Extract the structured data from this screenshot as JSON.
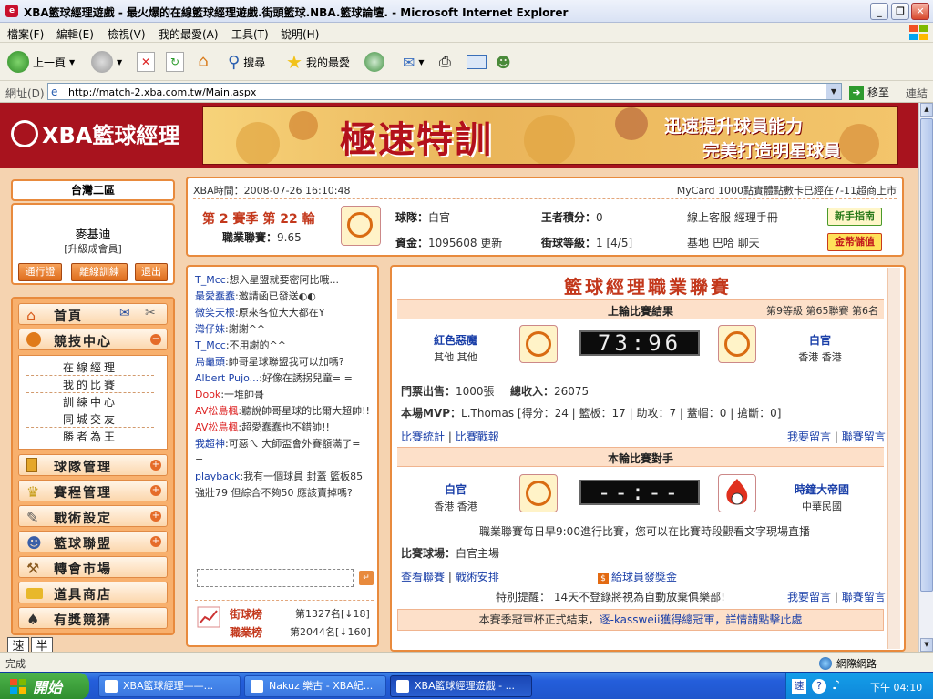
{
  "window": {
    "title": "XBA籃球經理遊戲 - 最火爆的在線籃球經理遊戲.街頭籃球.NBA.籃球論壇. - Microsoft Internet Explorer"
  },
  "menu": [
    "檔案(F)",
    "編輯(E)",
    "檢視(V)",
    "我的最愛(A)",
    "工具(T)",
    "說明(H)"
  ],
  "toolbar": {
    "back": "上一頁",
    "search": "搜尋",
    "favorites": "我的最愛"
  },
  "address": {
    "label": "網址(D)",
    "url": "http://match-2.xba.com.tw/Main.aspx",
    "go": "移至",
    "links": "連結"
  },
  "header": {
    "logo": "XBA籃球經理",
    "banner_big": "極速特訓",
    "banner_line1": "迅速提升球員能力",
    "banner_line2": "完美打造明星球員"
  },
  "left": {
    "server": "台灣二區",
    "user_name": "麥基迪",
    "user_role": "[升級成會員]",
    "buttons": [
      "通行證",
      "離線訓練",
      "退出"
    ],
    "nav": {
      "home": "首頁",
      "competition": "競技中心",
      "sub": [
        "在線經理",
        "我的比賽",
        "訓練中心",
        "同城交友",
        "勝者為王"
      ],
      "team": "球隊管理",
      "schedule": "賽程管理",
      "tactics": "戰術設定",
      "alliance": "籃球聯盟",
      "transfer": "轉會市場",
      "shop": "道具商店",
      "prize": "有獎競猜"
    },
    "speed": [
      "速",
      "半"
    ]
  },
  "info": {
    "time_label": "XBA時間：",
    "time": "2008-07-26 16:10:48",
    "news": "MyCard 1000點實體點數卡已經在7-11超商上市",
    "season": "第 2 賽季  第 22 輪",
    "league_label": "職業聯賽：",
    "league_value": "9.65",
    "team_label": "球隊：",
    "team": "白官",
    "king_label": "王者積分：",
    "king": "0",
    "service": "線上客服  經理手冊",
    "newbie": "新手指南",
    "money_label": "資金：",
    "money": "1095608",
    "update": "更新",
    "level_label": "街球等級：",
    "level": "1 [4/5]",
    "links": "基地  巴哈  聊天",
    "gold": "金幣儲值"
  },
  "chat": {
    "lines": [
      {
        "nick": "T_Mcc",
        "msg": ":想入星盟就要密阿比哦..."
      },
      {
        "nick": "最愛蠢蠢",
        "msg": ":邀請函已發送◐◐"
      },
      {
        "nick": "微笑天根",
        "msg": ":原來各位大大都在Y"
      },
      {
        "nick": "灣仔妹",
        "msg": ":謝謝^^"
      },
      {
        "nick": "T_Mcc",
        "msg": ":不用謝的^^"
      },
      {
        "nick": "烏龜頭",
        "msg": ":帥哥星球聯盟我可以加嗎?"
      },
      {
        "nick": "Albert Pujo...",
        "msg": ":好像在誘拐兒童= ="
      },
      {
        "nick": "Dook",
        "msg": ":一堆帥哥"
      },
      {
        "nick": "AV松島楓",
        "msg": ":聽說帥哥星球的比爾大超帥!!"
      },
      {
        "nick": "AV松島楓",
        "msg": ":超愛蠢蠢也不錯帥!!"
      },
      {
        "nick": "我超神",
        "msg": ":可惡ㄟ 大師盃會外賽額滿了= ="
      },
      {
        "nick": "playback",
        "msg": ":我有一個球員 封蓋 籃板85 強壯79 但綜合不夠50 應該賣掉嗎?"
      }
    ],
    "rank1_label": "街球榜",
    "rank1": "第1327名[↓18]",
    "rank2_label": "職業榜",
    "rank2": "第2044名[↓160]"
  },
  "league": {
    "title": "籃球經理職業聯賽",
    "last_title": "上輪比賽結果",
    "last_info": "第9等級  第65聯賽  第6名",
    "home_team": "紅色惡魔",
    "home_region": "其他  其他",
    "score": "73:96",
    "away_team": "白官",
    "away_region": "香港  香港",
    "tickets_label": "門票出售：",
    "tickets": "1000張",
    "income_label": "總收入：",
    "income": "26075",
    "mvp_label": "本場MVP：",
    "mvp": "L.Thomas  [得分：24 | 籃板：17 | 助攻：7 | 蓋帽：0 | 搶斷：0]",
    "stats_link": "比賽統計",
    "live_link": "比賽戰報",
    "msg_link": "我要留言",
    "league_msg_link": "聯賽留言",
    "next_title": "本輪比賽對手",
    "next_home": "白官",
    "next_home_region": "香港  香港",
    "next_score": "--:--",
    "next_away": "時鐘大帝國",
    "next_away_region": "中華民國",
    "schedule_note": "職業聯賽每日早9:00進行比賽，您可以在比賽時段觀看文字現場直播",
    "venue_label": "比賽球場：",
    "venue": "白官主場",
    "view_league": "查看聯賽",
    "tactics_link": "戰術安排",
    "bonus": "給球員發獎金",
    "reminder": "特別提醒：  14天不登錄將視為自動放棄俱樂部!",
    "msg_link2": "我要留言",
    "league_msg_link2": "聯賽留言",
    "notice": "本賽季冠軍杯正式結束，",
    "notice_link": "逐-kassweii獲得總冠軍，詳情請點擊此處"
  },
  "status": {
    "left": "完成",
    "zone": "網際網路"
  },
  "taskbar": {
    "start": "開始",
    "tasks": [
      "XBA籃球經理——...",
      "Nakuz 樂古 - XBA紀...",
      "XBA籃球經理遊戲 - ..."
    ],
    "clock": "下午 04:10"
  }
}
